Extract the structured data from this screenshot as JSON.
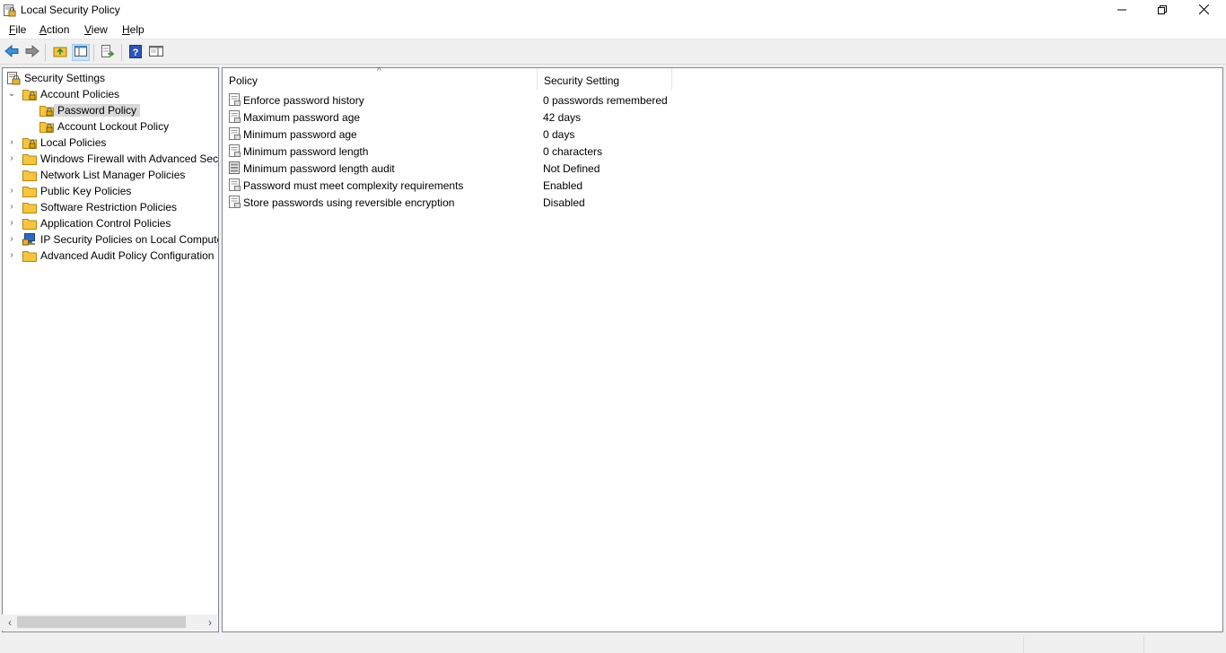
{
  "window": {
    "title": "Local Security Policy",
    "minimize_icon": "minimize-icon",
    "maximize_icon": "restore-icon",
    "close_icon": "close-icon"
  },
  "menu": [
    "File",
    "Action",
    "View",
    "Help"
  ],
  "toolbar": {
    "buttons": [
      "back-arrow-icon",
      "forward-arrow-icon",
      "up-folder-icon",
      "show-hide-console-tree-icon",
      "export-list-icon",
      "help-icon",
      "show-hide-action-pane-icon"
    ]
  },
  "tree": {
    "root": "Security Settings",
    "items": [
      {
        "label": "Account Policies",
        "expanded": true
      },
      {
        "label": "Password Policy",
        "selected": true
      },
      {
        "label": "Account Lockout Policy"
      },
      {
        "label": "Local Policies"
      },
      {
        "label": "Windows Firewall with Advanced Security"
      },
      {
        "label": "Network List Manager Policies"
      },
      {
        "label": "Public Key Policies"
      },
      {
        "label": "Software Restriction Policies"
      },
      {
        "label": "Application Control Policies"
      },
      {
        "label": "IP Security Policies on Local Computer"
      },
      {
        "label": "Advanced Audit Policy Configuration"
      }
    ]
  },
  "list": {
    "columns": [
      "Policy",
      "Security Setting"
    ],
    "rows": [
      {
        "policy": "Enforce password history",
        "setting": "0 passwords remembered"
      },
      {
        "policy": "Maximum password age",
        "setting": "42 days"
      },
      {
        "policy": "Minimum password age",
        "setting": "0 days"
      },
      {
        "policy": "Minimum password length",
        "setting": "0 characters"
      },
      {
        "policy": "Minimum password length audit",
        "setting": "Not Defined"
      },
      {
        "policy": "Password must meet complexity requirements",
        "setting": "Enabled"
      },
      {
        "policy": "Store passwords using reversible encryption",
        "setting": "Disabled"
      }
    ]
  },
  "colors": {
    "accent": "#3c8fd8",
    "folder": "#f5c542",
    "selected_bg": "#d9d9d9"
  }
}
